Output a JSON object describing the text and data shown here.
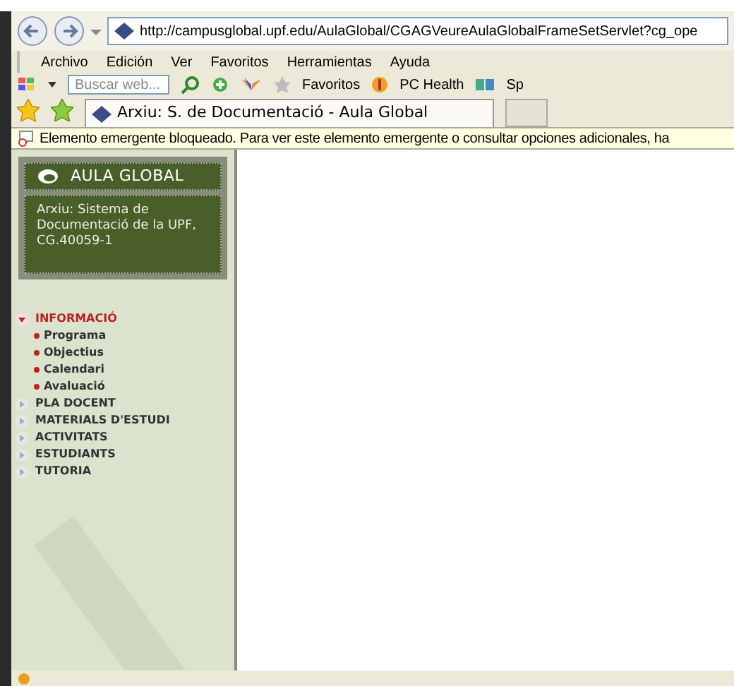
{
  "address_bar": {
    "url": "http://campusglobal.upf.edu/AulaGlobal/CGAGVeureAulaGlobalFrameSetServlet?cg_ope"
  },
  "menu_bar": [
    "Archivo",
    "Edición",
    "Ver",
    "Favoritos",
    "Herramientas",
    "Ayuda"
  ],
  "toolbar": {
    "search": {
      "placeholder": "Buscar web..."
    },
    "favorites": "Favoritos",
    "pc_health": "PC Health",
    "cut_item": "Sp"
  },
  "tabs": [
    {
      "label": "Arxiu: S. de Documentació - Aula Global",
      "selected": true
    }
  ],
  "info_bar": "Elemento emergente bloqueado. Para ver este elemento emergente o consultar opciones adicionales, ha",
  "sidebar": {
    "logo": "AULA GLOBAL",
    "course": "Arxiu: Sistema de Documentació de la UPF, CG.40059-1",
    "nav": [
      {
        "label": "INFORMACIÓ",
        "expanded": true,
        "children": [
          {
            "label": "Programa"
          },
          {
            "label": "Objectius"
          },
          {
            "label": "Calendari"
          },
          {
            "label": "Avaluació"
          }
        ]
      },
      {
        "label": "PLA DOCENT",
        "expanded": false
      },
      {
        "label": "MATERIALS D'ESTUDI",
        "expanded": false
      },
      {
        "label": "ACTIVITATS",
        "expanded": false
      },
      {
        "label": "ESTUDIANTS",
        "expanded": false
      },
      {
        "label": "TUTORIA",
        "expanded": false
      }
    ]
  }
}
